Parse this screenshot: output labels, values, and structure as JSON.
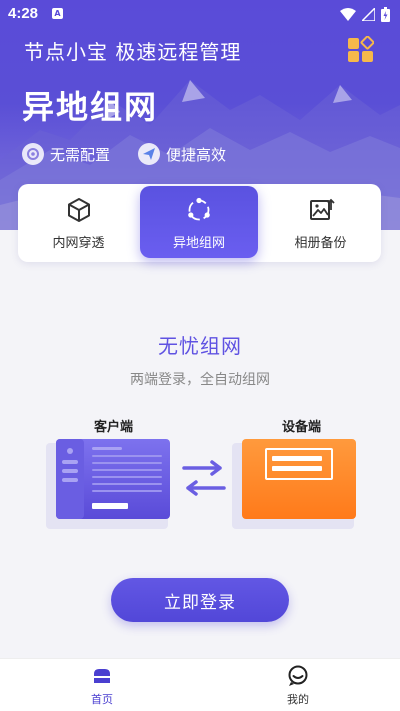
{
  "status_bar": {
    "time": "4:28",
    "notif_letter": "A"
  },
  "header": {
    "app_title": "节点小宝 极速远程管理",
    "page_title": "异地组网",
    "features": [
      {
        "label": "无需配置",
        "icon": "config-free-icon"
      },
      {
        "label": "便捷高效",
        "icon": "paper-plane-icon"
      }
    ]
  },
  "tabs": [
    {
      "label": "内网穿透",
      "icon": "cube-icon",
      "active": false
    },
    {
      "label": "异地组网",
      "icon": "network-nodes-icon",
      "active": true
    },
    {
      "label": "相册备份",
      "icon": "image-upload-icon",
      "active": false
    }
  ],
  "main": {
    "title": "无忧组网",
    "subtitle": "两端登录，全自动组网",
    "client_label": "客户端",
    "device_label": "设备端",
    "login_button": "立即登录"
  },
  "bottom_nav": [
    {
      "label": "首页",
      "icon": "home-icon",
      "active": true
    },
    {
      "label": "我的",
      "icon": "profile-icon",
      "active": false
    }
  ],
  "colors": {
    "primary": "#5a4bd8",
    "accent_orange": "#ff7a1a",
    "text_primary": "#333333"
  }
}
